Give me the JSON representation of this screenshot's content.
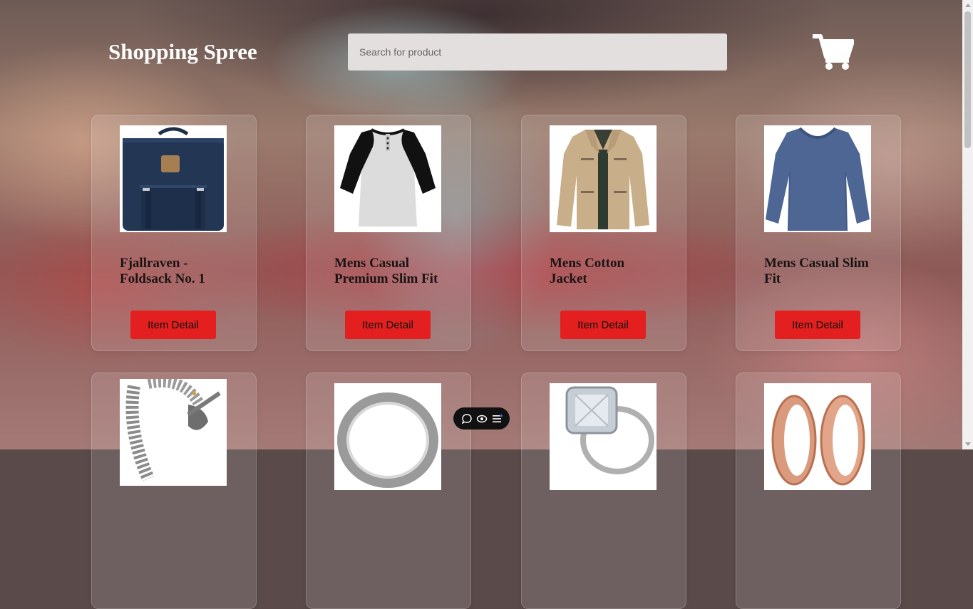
{
  "header": {
    "brand": "Shopping Spree",
    "search_placeholder": "Search for product",
    "cart_icon": "cart-icon"
  },
  "products": [
    {
      "title": "Fjallraven - Foldsack No. 1",
      "button": "Item Detail",
      "image": "backpack"
    },
    {
      "title": "Mens Casual Premium Slim Fit",
      "button": "Item Detail",
      "image": "raglan-tshirt"
    },
    {
      "title": "Mens Cotton Jacket",
      "button": "Item Detail",
      "image": "cotton-jacket"
    },
    {
      "title": "Mens Casual Slim Fit",
      "button": "Item Detail",
      "image": "long-sleeve-shirt"
    },
    {
      "title": "",
      "button": "",
      "image": "dragon-bracelet"
    },
    {
      "title": "",
      "button": "",
      "image": "silver-ring"
    },
    {
      "title": "",
      "button": "",
      "image": "diamond-ring"
    },
    {
      "title": "",
      "button": "",
      "image": "rose-gold-rings"
    }
  ],
  "floating_toolbar": {
    "icons": [
      "chat-bubble-icon",
      "eye-icon",
      "menu-icon"
    ]
  },
  "colors": {
    "button": "#e3201f",
    "search_bg": "#e4dfdf",
    "brand_text": "#ffffff"
  }
}
